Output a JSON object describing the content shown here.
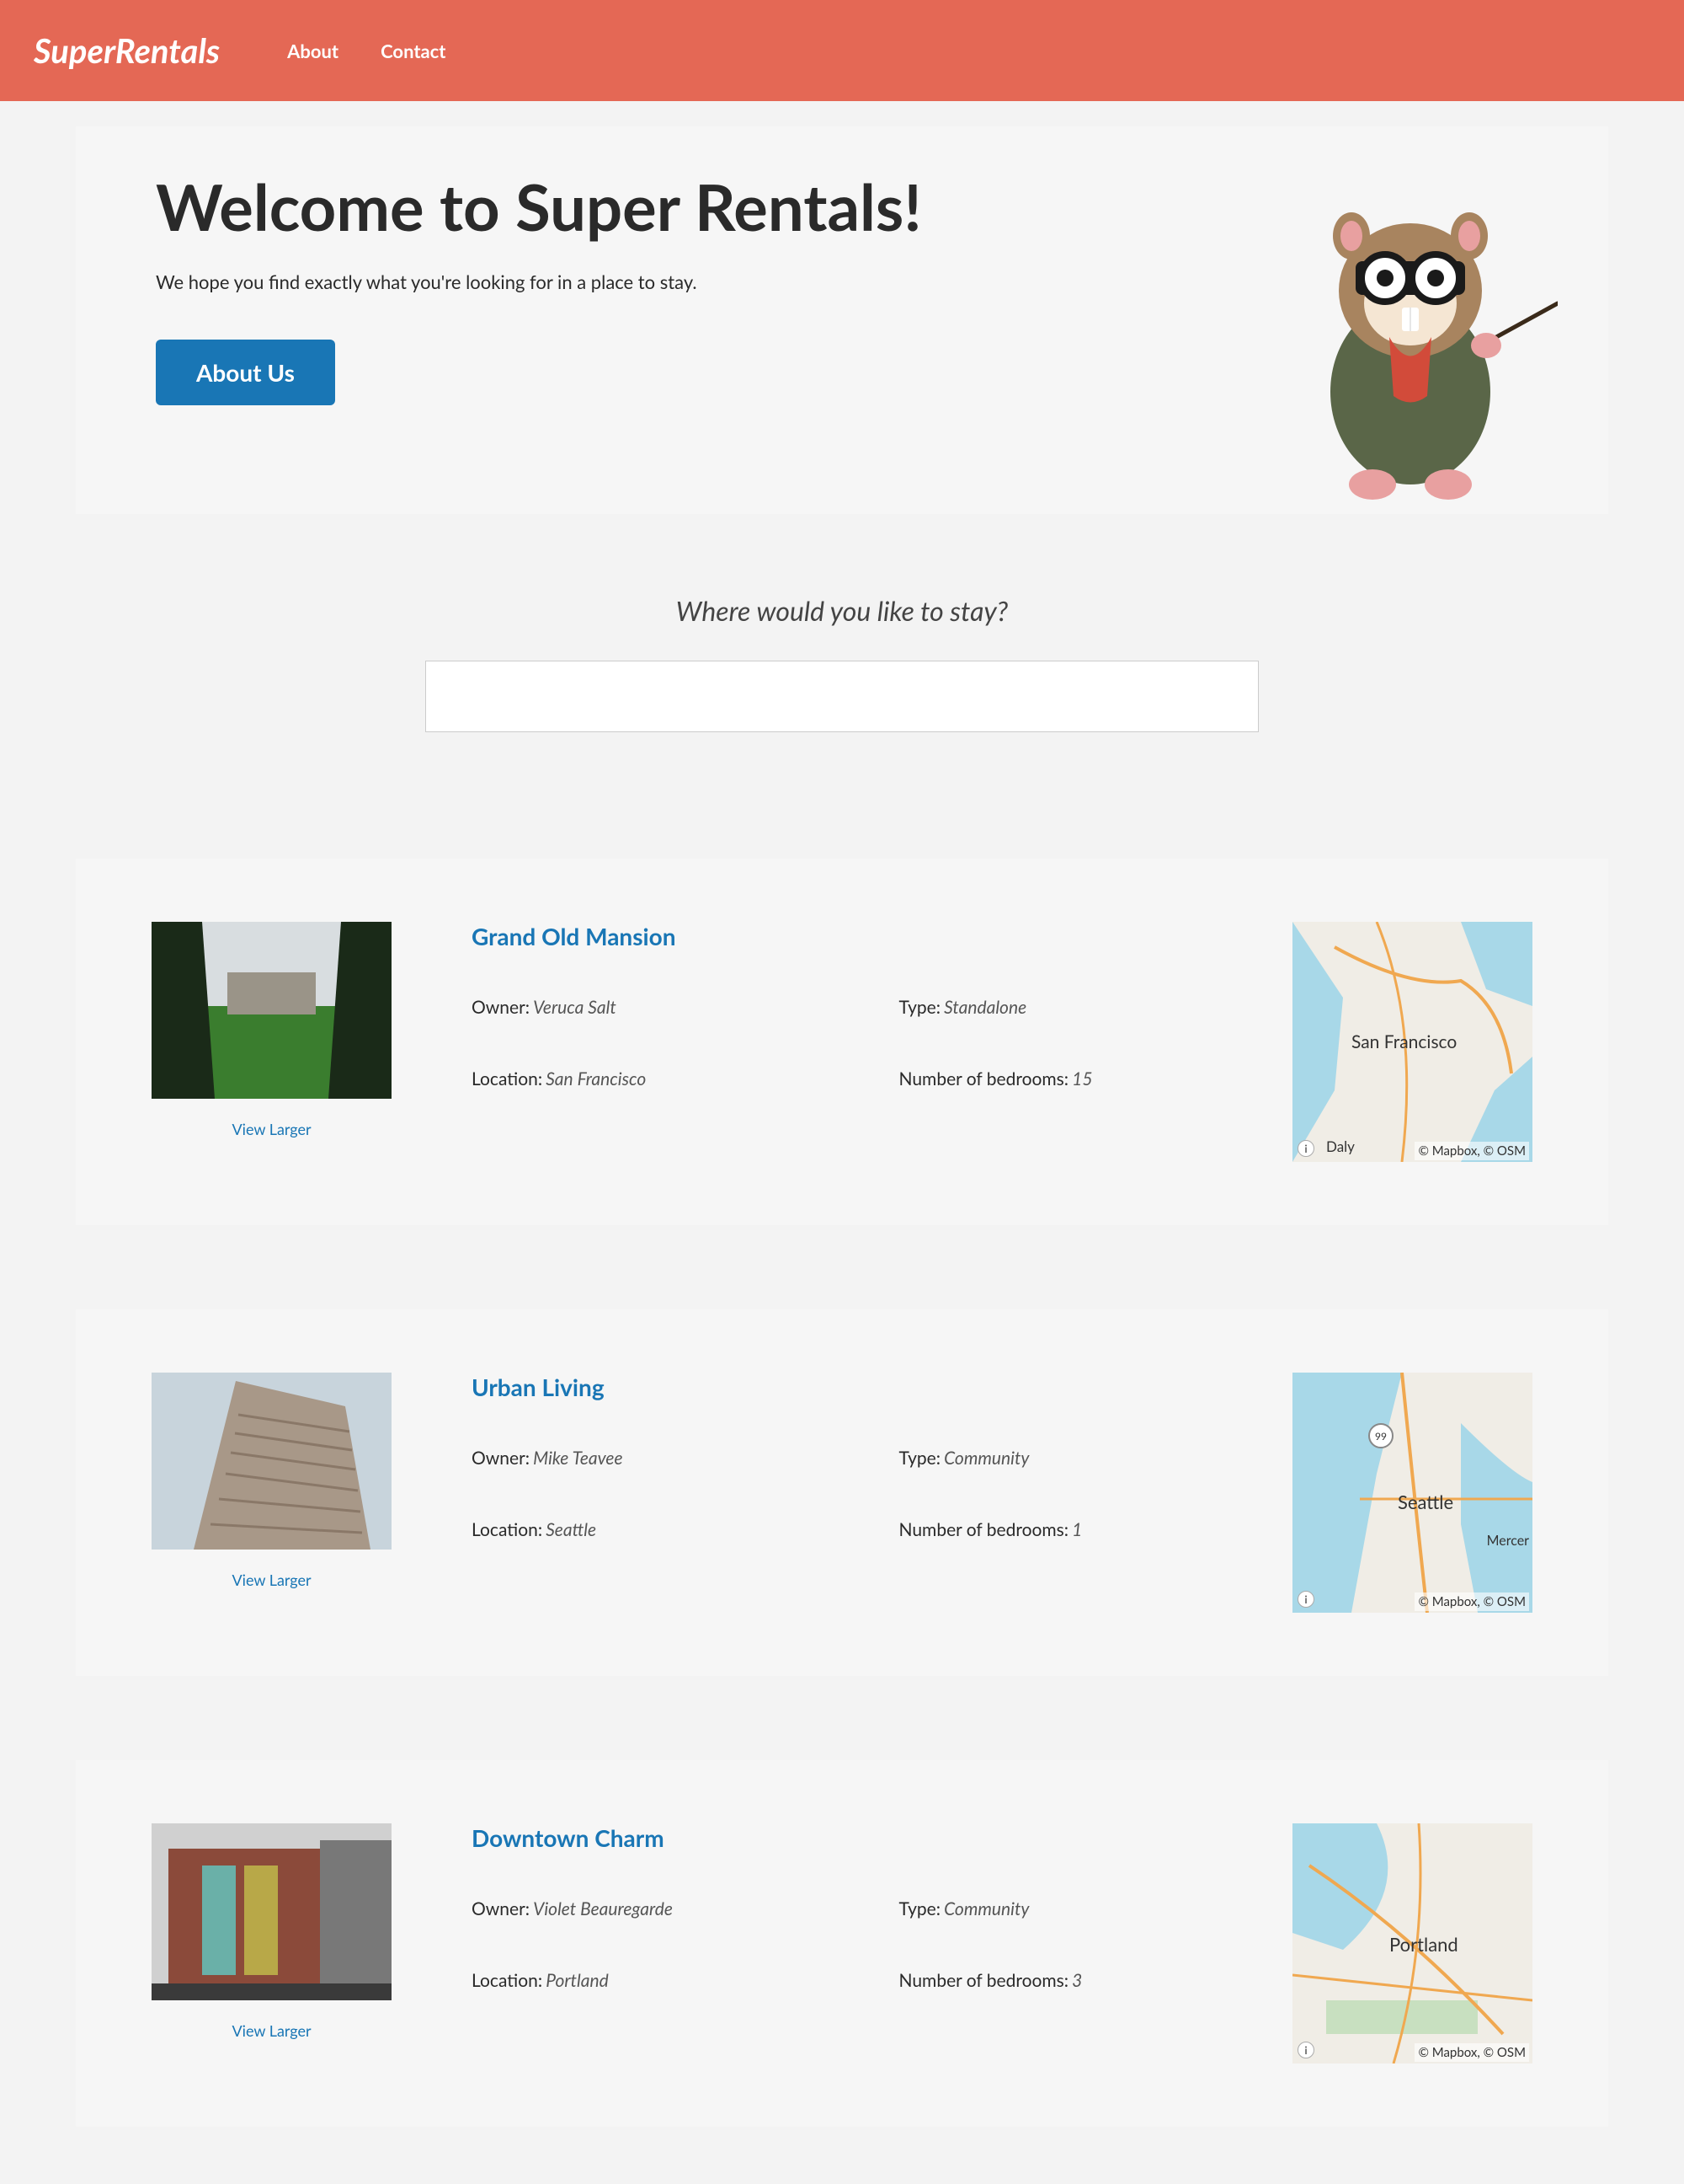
{
  "nav": {
    "logo": "SuperRentals",
    "about": "About",
    "contact": "Contact"
  },
  "jumbo": {
    "title": "Welcome to Super Rentals!",
    "subtitle": "We hope you find exactly what you're looking for in a place to stay.",
    "button": "About Us"
  },
  "search": {
    "label": "Where would you like to stay?",
    "value": ""
  },
  "labels": {
    "owner": "Owner:",
    "type": "Type:",
    "location": "Location:",
    "bedrooms": "Number of bedrooms:",
    "view_larger": "View Larger",
    "map_attribution": "© Mapbox, © OSM"
  },
  "rentals": [
    {
      "title": "Grand Old Mansion",
      "owner": "Veruca Salt",
      "type": "Standalone",
      "location": "San Francisco",
      "bedrooms": "15",
      "map_city": "San Francisco",
      "map_city2": "Daly"
    },
    {
      "title": "Urban Living",
      "owner": "Mike Teavee",
      "type": "Community",
      "location": "Seattle",
      "bedrooms": "1",
      "map_city": "Seattle",
      "map_city2": "Mercer"
    },
    {
      "title": "Downtown Charm",
      "owner": "Violet Beauregarde",
      "type": "Community",
      "location": "Portland",
      "bedrooms": "3",
      "map_city": "Portland",
      "map_city2": ""
    }
  ]
}
